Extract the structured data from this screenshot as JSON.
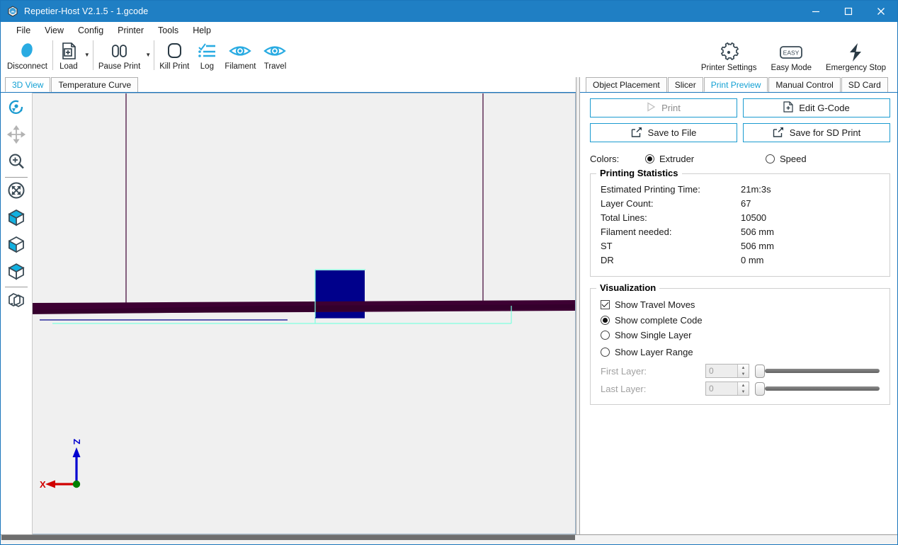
{
  "window": {
    "title": "Repetier-Host V2.1.5 - 1.gcode",
    "app_icon": "repetier-logo-icon",
    "minimize": "—",
    "maximize": "☐",
    "close": "✕",
    "titlebar_color": "#1f7fc4"
  },
  "menu": {
    "items": [
      {
        "label": "File"
      },
      {
        "label": "View"
      },
      {
        "label": "Config"
      },
      {
        "label": "Printer"
      },
      {
        "label": "Tools"
      },
      {
        "label": "Help"
      }
    ]
  },
  "toolbar": {
    "left": [
      {
        "label": "Disconnect",
        "icon": "connection-blob-icon",
        "dropdown": false
      },
      {
        "label": "Load",
        "icon": "load-file-icon",
        "dropdown": true
      },
      {
        "label": "Pause Print",
        "icon": "pause-icon",
        "dropdown": true
      },
      {
        "label": "Kill Print",
        "icon": "stop-rounded-icon",
        "dropdown": false
      },
      {
        "label": "Log",
        "icon": "log-checklist-icon",
        "dropdown": false
      },
      {
        "label": "Filament",
        "icon": "eye-icon",
        "dropdown": false
      },
      {
        "label": "Travel",
        "icon": "eye-icon",
        "dropdown": false
      }
    ],
    "right": [
      {
        "label": "Printer Settings",
        "icon": "gear-icon"
      },
      {
        "label": "Easy Mode",
        "icon": "easy-badge-icon"
      },
      {
        "label": "Emergency Stop",
        "icon": "lightning-bolt-icon"
      }
    ]
  },
  "left_pane": {
    "tabs": [
      {
        "label": "3D View",
        "active": true
      },
      {
        "label": "Temperature Curve",
        "active": false
      }
    ],
    "sidebar": [
      {
        "name": "rotate-view-tool",
        "icon": "rotate-icon",
        "state": "active"
      },
      {
        "name": "move-view-tool",
        "icon": "move-arrows-icon",
        "state": "disabled"
      },
      {
        "name": "zoom-view-tool",
        "icon": "magnifier-plus-icon",
        "state": "normal"
      },
      {
        "name": "fit-to-view-tool",
        "icon": "expand-circle-icon",
        "state": "normal"
      },
      {
        "name": "view-mode-solid",
        "icon": "cube-solid-icon",
        "state": "normal"
      },
      {
        "name": "view-mode-shaded",
        "icon": "cube-shaded-icon",
        "state": "normal"
      },
      {
        "name": "view-mode-open",
        "icon": "cube-open-icon",
        "state": "normal"
      },
      {
        "name": "multi-object-view",
        "icon": "overlapping-cubes-icon",
        "state": "normal"
      }
    ],
    "axis_gizmo": {
      "x_label": "X",
      "z_label": "Z",
      "x_color": "#d00000",
      "z_color": "#0000d0",
      "origin_color": "#008000"
    },
    "scene": {
      "background": "#f0f0f0",
      "object_color": "#00008b",
      "bed_line_color": "#3d0033",
      "travel_move_color": "#7fffe0",
      "extrusion_color": "#00008b"
    }
  },
  "right_pane": {
    "tabs": [
      {
        "label": "Object Placement",
        "active": false
      },
      {
        "label": "Slicer",
        "active": false
      },
      {
        "label": "Print Preview",
        "active": true
      },
      {
        "label": "Manual Control",
        "active": false
      },
      {
        "label": "SD Card",
        "active": false
      }
    ],
    "actions": [
      {
        "label": "Print",
        "icon": "play-icon",
        "disabled": true
      },
      {
        "label": "Edit G-Code",
        "icon": "edit-file-icon",
        "disabled": false
      },
      {
        "label": "Save to File",
        "icon": "export-icon",
        "disabled": false
      },
      {
        "label": "Save for SD Print",
        "icon": "export-icon",
        "disabled": false
      }
    ],
    "colors": {
      "label": "Colors:",
      "options": [
        {
          "label": "Extruder",
          "selected": true
        },
        {
          "label": "Speed",
          "selected": false
        }
      ]
    },
    "printing_statistics": {
      "title": "Printing Statistics",
      "rows": [
        {
          "key": "Estimated Printing Time:",
          "value": "21m:3s"
        },
        {
          "key": "Layer Count:",
          "value": "67"
        },
        {
          "key": "Total Lines:",
          "value": "10500"
        },
        {
          "key": "Filament needed:",
          "value": "506 mm"
        },
        {
          "key": "ST",
          "value": "506 mm"
        },
        {
          "key": "DR",
          "value": "0 mm"
        }
      ]
    },
    "visualization": {
      "title": "Visualization",
      "show_travel_moves": {
        "label": "Show Travel Moves",
        "checked": true
      },
      "modes": [
        {
          "label": "Show complete Code",
          "selected": true
        },
        {
          "label": "Show Single Layer",
          "selected": false
        },
        {
          "label": "Show Layer Range",
          "selected": false
        }
      ],
      "first_layer": {
        "label": "First Layer:",
        "value": "0",
        "disabled": true,
        "slider_pos": 0
      },
      "last_layer": {
        "label": "Last Layer:",
        "value": "0",
        "disabled": true,
        "slider_pos": 0
      }
    }
  },
  "accent": {
    "teal": "#13a1d4",
    "button_border": "#1b9bd0",
    "title_blue": "#1f7fc4"
  }
}
